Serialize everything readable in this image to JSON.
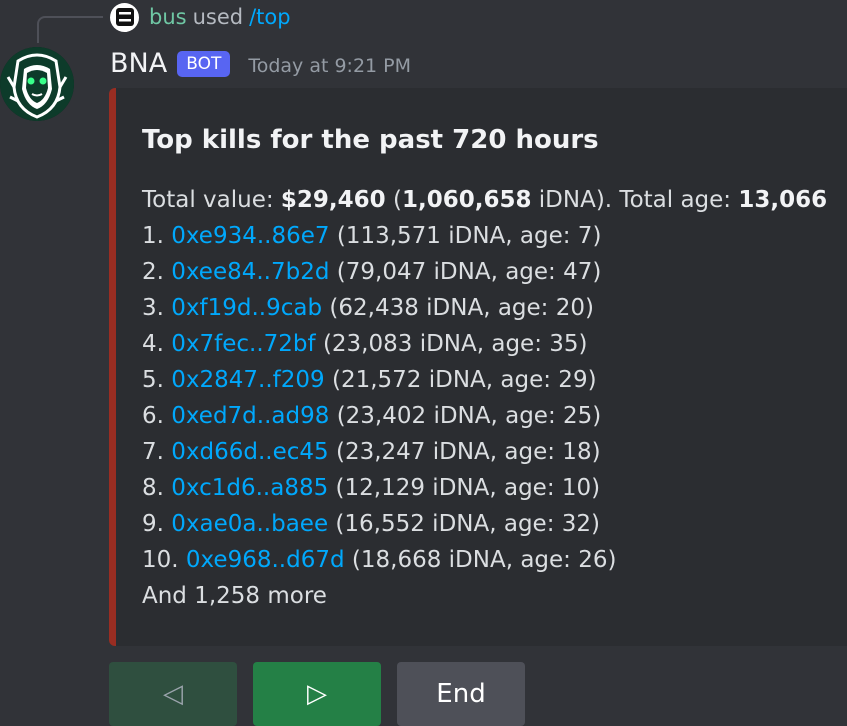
{
  "reply": {
    "username": "bus",
    "used_text": "used",
    "command": "/top"
  },
  "message": {
    "author": "BNA",
    "badge": "BOT",
    "timestamp": "Today at 9:21 PM"
  },
  "embed": {
    "accent_color": "#992d22",
    "title": "Top kills for the past 720 hours",
    "summary": {
      "total_value_label": "Total value: ",
      "total_value": "$29,460",
      "idna_open": " (",
      "total_idna": "1,060,658",
      "idna_close": " iDNA). Total age: ",
      "total_age": "13,066"
    },
    "entries": [
      {
        "rank": "1.",
        "address": "0xe934..86e7",
        "details": "(113,571 iDNA, age: 7)"
      },
      {
        "rank": "2.",
        "address": "0xee84..7b2d",
        "details": "(79,047 iDNA, age: 47)"
      },
      {
        "rank": "3.",
        "address": "0xf19d..9cab",
        "details": "(62,438 iDNA, age: 20)"
      },
      {
        "rank": "4.",
        "address": "0x7fec..72bf",
        "details": "(23,083 iDNA, age: 35)"
      },
      {
        "rank": "5.",
        "address": "0x2847..f209",
        "details": "(21,572 iDNA, age: 29)"
      },
      {
        "rank": "6.",
        "address": "0xed7d..ad98",
        "details": "(23,402 iDNA, age: 25)"
      },
      {
        "rank": "7.",
        "address": "0xd66d..ec45",
        "details": "(23,247 iDNA, age: 18)"
      },
      {
        "rank": "8.",
        "address": "0xc1d6..a885",
        "details": "(12,129 iDNA, age: 10)"
      },
      {
        "rank": "9.",
        "address": "0xae0a..baee",
        "details": "(16,552 iDNA, age: 32)"
      },
      {
        "rank": "10.",
        "address": "0xe968..d67d",
        "details": "(18,668 iDNA, age: 26)"
      }
    ],
    "footer": "And 1,258 more"
  },
  "buttons": {
    "prev_label": "◁",
    "next_label": "▷",
    "end_label": "End"
  }
}
